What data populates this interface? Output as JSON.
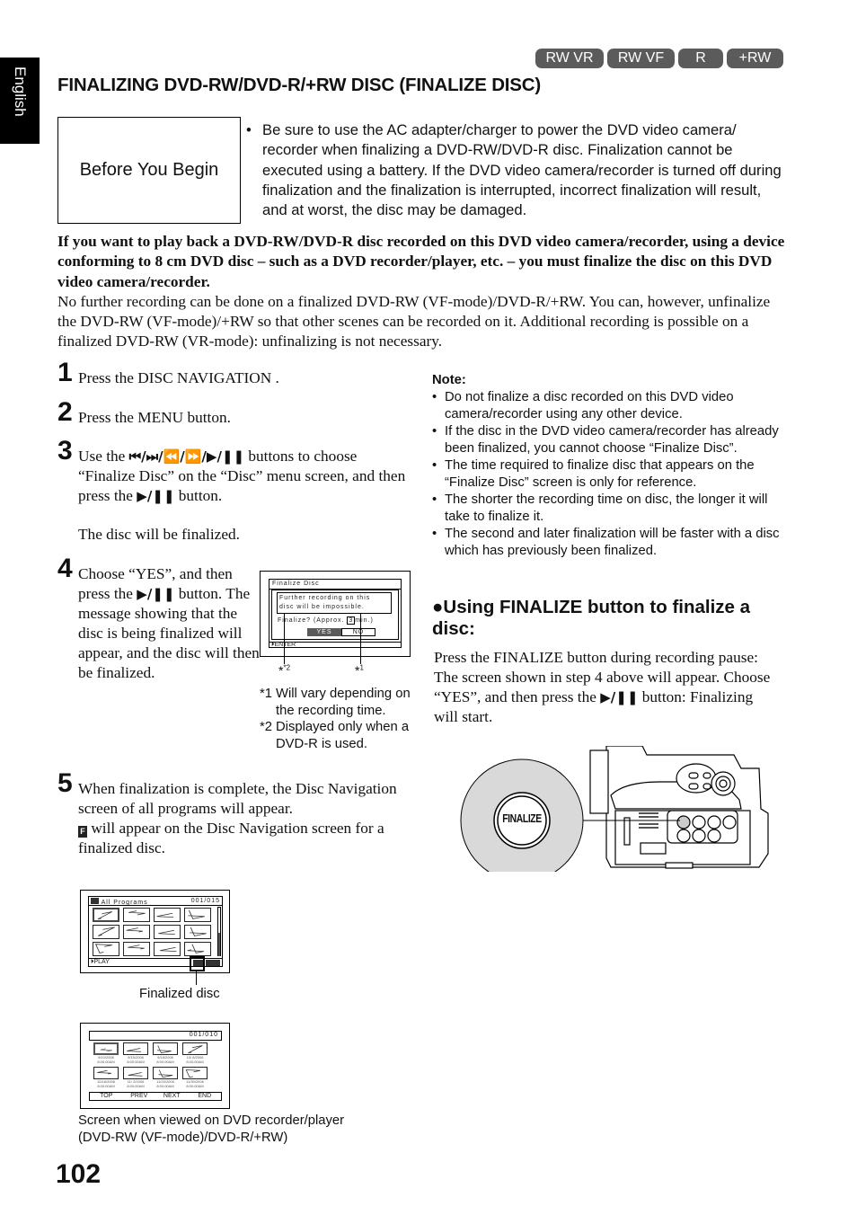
{
  "language_tab": "English",
  "badges": [
    "RW VR",
    "RW VF",
    "R",
    "+RW"
  ],
  "title": "FINALIZING DVD-RW/DVD-R/+RW DISC (FINALIZE DISC)",
  "before_you_begin": {
    "label": "Before You Begin",
    "bullet": "Be sure to use the AC adapter/charger to power the DVD video camera/ recorder when finalizing a DVD-RW/DVD-R disc. Finalization cannot be executed using a battery. If the DVD video camera/recorder is turned off during finalization and the finalization is interrupted, incorrect finalization will result, and at worst, the disc may be damaged."
  },
  "intro": {
    "bold": "If you want to play back a DVD-RW/DVD-R disc recorded on this DVD video camera/recorder, using a device conforming to 8 cm DVD disc – such as a DVD recorder/player, etc. – you must finalize the disc on this DVD video camera/recorder.",
    "normal": "No further recording can be done on a finalized DVD-RW (VF-mode)/DVD-R/+RW. You can, however, unfinalize the DVD-RW (VF-mode)/+RW so that other scenes can be recorded on it. Additional recording is possible on a finalized DVD-RW (VR-mode): unfinalizing is not necessary."
  },
  "steps": [
    {
      "num": "1",
      "text": "Press the DISC NAVIGATION ."
    },
    {
      "num": "2",
      "text": "Press the MENU button."
    },
    {
      "num": "3",
      "text_a": "Use the",
      "symbols": "⏮/⏭/⏪/⏩/▶/❚❚",
      "text_b": "buttons to choose “Finalize Disc” on the “Disc” menu screen, and then press the",
      "play_pause": "▶/❚❚",
      "text_c": "button.",
      "result": "The disc will be finalized."
    },
    {
      "num": "4",
      "text_a": "Choose “YES”, and then press the",
      "play_pause": "▶/❚❚",
      "text_b": "button. The message showing that the disc is being finalized will appear, and the disc will then be finalized."
    },
    {
      "num": "5",
      "text_a": "When finalization is complete, the Disc Navigation screen of all programs will appear.",
      "f_icon": "F",
      "text_b": "will appear on the Disc Navigation screen for a finalized disc."
    }
  ],
  "finalize_screen": {
    "title": "Finalize Disc",
    "message_line1": "Further recording on this",
    "message_line2": "disc will be impossible.",
    "question_pre": "Finalize? (Approx.",
    "minutes": "3",
    "question_post": "min.)",
    "yes": "YES",
    "no": "NO",
    "enter": "ENTER",
    "marker1": "*1",
    "marker2": "*2"
  },
  "footnotes": [
    {
      "mark": "*1",
      "text": "Will vary depending on the recording time."
    },
    {
      "mark": "*2",
      "text": "Displayed only when a DVD-R is used."
    }
  ],
  "nav_screen": {
    "title": "All Programs",
    "counter": "001/015",
    "play": "PLAY",
    "caption": "Finalized disc"
  },
  "player_screen": {
    "counter": "001/010",
    "dates": [
      [
        "9/10/2006",
        "8:00:00AM"
      ],
      [
        "9/15/2006",
        "8:00:00AM"
      ],
      [
        "9/18/2006",
        "8:00:00AM"
      ],
      [
        "10/ 8/2006",
        "8:00:00AM"
      ],
      [
        "10/18/2006",
        "8:00:00AM"
      ],
      [
        "11/ 2/2006",
        "8:00:00AM"
      ],
      [
        "11/20/2006",
        "8:00:00AM"
      ],
      [
        "11/30/2006",
        "8:00:00AM"
      ]
    ],
    "buttons": [
      "TOP",
      "PREV",
      "NEXT",
      "END"
    ],
    "caption": "Screen when viewed on DVD recorder/player (DVD-RW (VF-mode)/DVD-R/+RW)"
  },
  "note": {
    "heading": "Note:",
    "items": [
      "Do not finalize a disc recorded on this DVD video camera/recorder using any other device.",
      "If the disc in the DVD video camera/recorder has already been finalized, you cannot choose “Finalize Disc”.",
      "The time required to finalize disc that appears on the “Finalize Disc” screen is only for reference.",
      "The shorter the recording time on disc, the longer it will take to finalize it.",
      "The second and later finalization will be faster with a disc which has previously been finalized."
    ]
  },
  "finalize_button_section": {
    "heading": "Using FINALIZE button to finalize a disc:",
    "body_a": "Press the FINALIZE button during recording pause: The screen shown in step 4 above will appear. Choose “YES”, and then press the",
    "play_pause": "▶/❚❚",
    "body_b": "button: Finalizing will start.",
    "button_label": "FINALIZE"
  },
  "page_number": "102"
}
